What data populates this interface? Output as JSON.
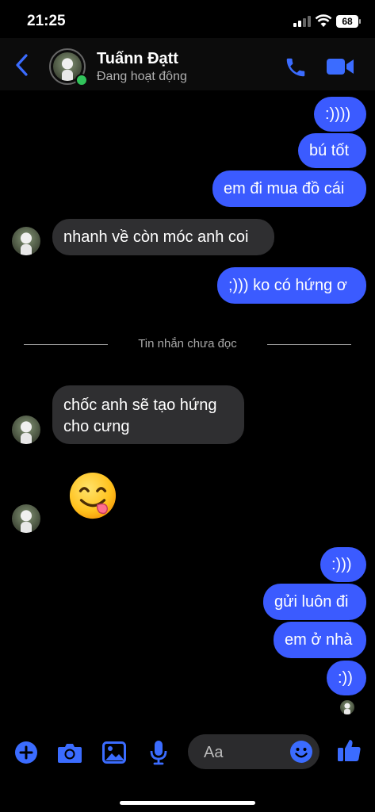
{
  "status_bar": {
    "time": "21:25",
    "battery": "68"
  },
  "header": {
    "contact_name": "Tuấnn Đạtt",
    "contact_status": "Đang hoạt động"
  },
  "messages": [
    {
      "side": "out",
      "text": ":))))"
    },
    {
      "side": "out",
      "text": "bú tốt"
    },
    {
      "side": "out",
      "text": "em đi mua đồ cái"
    },
    {
      "side": "in",
      "text": "nhanh về còn móc anh coi"
    },
    {
      "side": "out",
      "text": ";))) ko có hứng ơ"
    },
    {
      "side": "in",
      "text": "chốc anh sẽ tạo hứng cho cưng"
    },
    {
      "side": "in",
      "emoji": "yummy-face"
    },
    {
      "side": "out",
      "text": ":)))"
    },
    {
      "side": "out",
      "text": "gửi luôn đi"
    },
    {
      "side": "out",
      "text": "em ở nhà"
    },
    {
      "side": "out",
      "text": ":))"
    }
  ],
  "unread_divider": "Tin nhắn chưa đọc",
  "composer": {
    "placeholder": "Aa"
  },
  "colors": {
    "accent": "#3b5bff",
    "outgoing_bubble": "#3b5bff",
    "incoming_bubble": "#2f2f31",
    "online": "#31c45b",
    "background": "#000000"
  },
  "icons": [
    "back-chevron-icon",
    "phone-icon",
    "video-camera-icon",
    "plus-icon",
    "camera-icon",
    "gallery-icon",
    "microphone-icon",
    "emoji-icon",
    "thumbs-up-icon"
  ]
}
